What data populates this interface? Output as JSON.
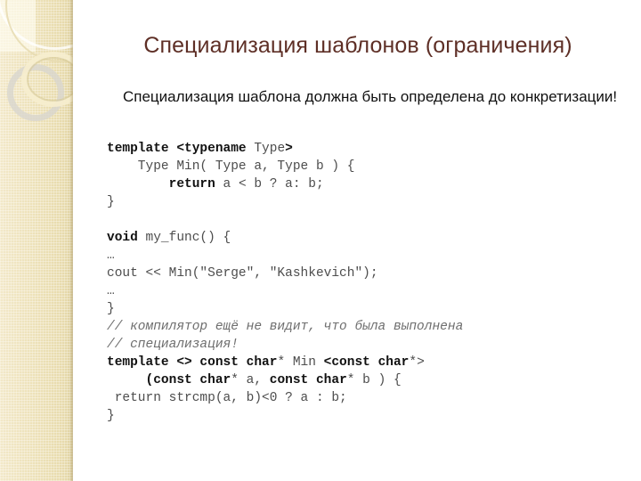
{
  "slide": {
    "title": "Специализация шаблонов (ограничения)",
    "title_color": "#5e2f26",
    "background_color": "#ffffff",
    "sidebar_color": "#ece0b6",
    "body_text": "Специализация шаблона должна быть определена до конкретизации!",
    "body_color": "#111111"
  },
  "code": {
    "font_color": "#4d4d4d",
    "keyword_color": "#111111",
    "comment_color": "#6e6e6e",
    "lines": [
      {
        "id": "l1",
        "segments": [
          {
            "t": "template <typename",
            "b": true
          },
          {
            "t": " Type",
            "b": false
          },
          {
            "t": ">",
            "b": true
          }
        ]
      },
      {
        "id": "l2",
        "segments": [
          {
            "t": "    Type Min( Type a, Type b ) {",
            "b": false
          }
        ]
      },
      {
        "id": "l3",
        "segments": [
          {
            "t": "        ",
            "b": false
          },
          {
            "t": "return",
            "b": true
          },
          {
            "t": " a < b ? a: b;",
            "b": false
          }
        ]
      },
      {
        "id": "l4",
        "segments": [
          {
            "t": "}",
            "b": false
          }
        ]
      },
      {
        "id": "l5",
        "segments": [
          {
            "t": " ",
            "b": false
          }
        ]
      },
      {
        "id": "l6",
        "segments": [
          {
            "t": "void",
            "b": true
          },
          {
            "t": " my_func() {",
            "b": false
          }
        ]
      },
      {
        "id": "l7",
        "segments": [
          {
            "t": "…",
            "b": false
          }
        ]
      },
      {
        "id": "l8",
        "segments": [
          {
            "t": "cout << Min(\"Serge\", \"Kashkevich\");",
            "b": false
          }
        ]
      },
      {
        "id": "l9",
        "segments": [
          {
            "t": "…",
            "b": false
          }
        ]
      },
      {
        "id": "l10",
        "segments": [
          {
            "t": "}",
            "b": false
          }
        ]
      },
      {
        "id": "l11",
        "comment": true,
        "segments": [
          {
            "t": "// компилятор ещё не видит, что была выполнена",
            "b": false
          }
        ]
      },
      {
        "id": "l12",
        "comment": true,
        "segments": [
          {
            "t": "// специализация!",
            "b": false
          }
        ]
      },
      {
        "id": "l13",
        "segments": [
          {
            "t": "template <> const char",
            "b": true
          },
          {
            "t": "* Min ",
            "b": false
          },
          {
            "t": "<const char",
            "b": true
          },
          {
            "t": "*>",
            "b": false
          }
        ]
      },
      {
        "id": "l14",
        "segments": [
          {
            "t": "     (",
            "b": true
          },
          {
            "t": "",
            "b": false
          },
          {
            "t": "const char",
            "b": true
          },
          {
            "t": "* a, ",
            "b": false
          },
          {
            "t": "const char",
            "b": true
          },
          {
            "t": "* b ) {",
            "b": false
          }
        ]
      },
      {
        "id": "l15",
        "segments": [
          {
            "t": " return strcmp(a, b)<0 ? a : b;",
            "b": false
          }
        ]
      },
      {
        "id": "l16",
        "segments": [
          {
            "t": "}",
            "b": false
          }
        ]
      }
    ]
  }
}
